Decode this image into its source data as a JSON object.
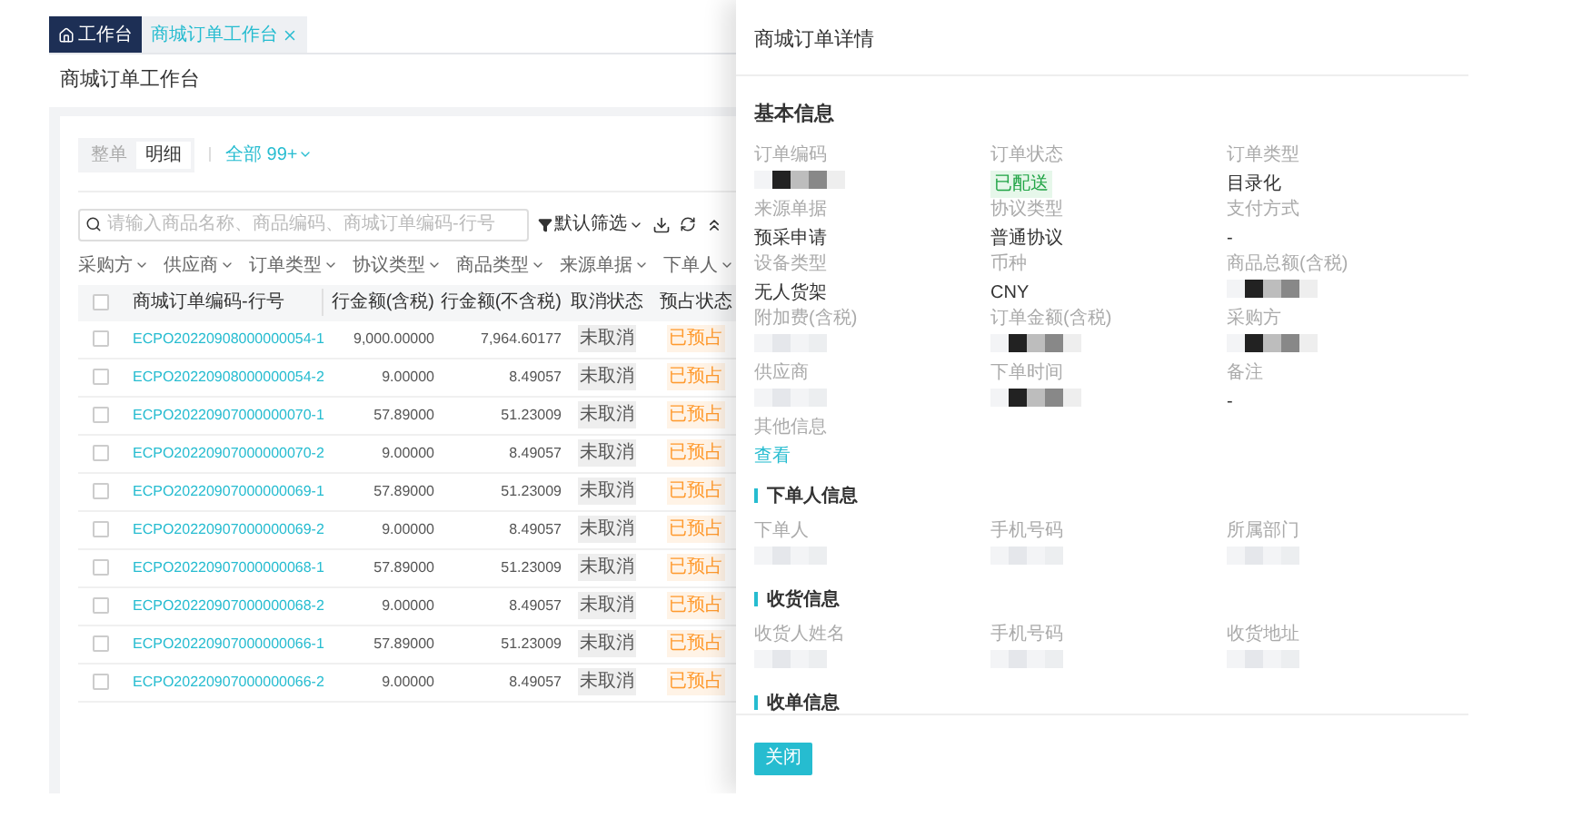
{
  "tabs": [
    {
      "label": "工作台",
      "selected": true,
      "closable": false
    },
    {
      "label": "商城订单工作台",
      "selected": false,
      "closable": true
    }
  ],
  "page_title": "商城订单工作台",
  "view_toggle": [
    {
      "label": "整单",
      "selected": false
    },
    {
      "label": "明细",
      "selected": true
    }
  ],
  "scope_filter": "全部 99+",
  "search": {
    "placeholder": "请输入商品名称、商品编码、商城订单编码-行号"
  },
  "default_filter": "默认筛选",
  "filters": [
    "采购方",
    "供应商",
    "订单类型",
    "协议类型",
    "商品类型",
    "来源单据",
    "下单人"
  ],
  "table": {
    "columns": [
      "商城订单编码-行号",
      "行金额(含税)",
      "行金额(不含税)",
      "取消状态",
      "预占状态"
    ],
    "all_checked": false,
    "rows": [
      {
        "checked": false,
        "code": "ECPO20220908000000054-1",
        "amount_tax": "9,000.00000",
        "amount_net": "7,964.60177",
        "cancel_status": "未取消",
        "reserve_status": "已预占"
      },
      {
        "checked": false,
        "code": "ECPO20220908000000054-2",
        "amount_tax": "9.00000",
        "amount_net": "8.49057",
        "cancel_status": "未取消",
        "reserve_status": "已预占"
      },
      {
        "checked": false,
        "code": "ECPO20220907000000070-1",
        "amount_tax": "57.89000",
        "amount_net": "51.23009",
        "cancel_status": "未取消",
        "reserve_status": "已预占"
      },
      {
        "checked": false,
        "code": "ECPO20220907000000070-2",
        "amount_tax": "9.00000",
        "amount_net": "8.49057",
        "cancel_status": "未取消",
        "reserve_status": "已预占"
      },
      {
        "checked": false,
        "code": "ECPO20220907000000069-1",
        "amount_tax": "57.89000",
        "amount_net": "51.23009",
        "cancel_status": "未取消",
        "reserve_status": "已预占"
      },
      {
        "checked": false,
        "code": "ECPO20220907000000069-2",
        "amount_tax": "9.00000",
        "amount_net": "8.49057",
        "cancel_status": "未取消",
        "reserve_status": "已预占"
      },
      {
        "checked": false,
        "code": "ECPO20220907000000068-1",
        "amount_tax": "57.89000",
        "amount_net": "51.23009",
        "cancel_status": "未取消",
        "reserve_status": "已预占"
      },
      {
        "checked": false,
        "code": "ECPO20220907000000068-2",
        "amount_tax": "9.00000",
        "amount_net": "8.49057",
        "cancel_status": "未取消",
        "reserve_status": "已预占"
      },
      {
        "checked": false,
        "code": "ECPO20220907000000066-1",
        "amount_tax": "57.89000",
        "amount_net": "51.23009",
        "cancel_status": "未取消",
        "reserve_status": "已预占"
      },
      {
        "checked": false,
        "code": "ECPO20220907000000066-2",
        "amount_tax": "9.00000",
        "amount_net": "8.49057",
        "cancel_status": "未取消",
        "reserve_status": "已预占"
      }
    ]
  },
  "drawer": {
    "title": "商城订单详情",
    "sections": [
      {
        "title": "基本信息",
        "fields": [
          {
            "label": "订单编码",
            "kind": "mosaic"
          },
          {
            "label": "订单状态",
            "kind": "tag",
            "value": "已配送"
          },
          {
            "label": "订单类型",
            "kind": "text",
            "value": "目录化"
          },
          {
            "label": "来源单据",
            "kind": "text",
            "value": "预采申请"
          },
          {
            "label": "协议类型",
            "kind": "text",
            "value": "普通协议"
          },
          {
            "label": "支付方式",
            "kind": "text",
            "value": "-"
          },
          {
            "label": "设备类型",
            "kind": "text",
            "value": "无人货架"
          },
          {
            "label": "币种",
            "kind": "text",
            "value": "CNY"
          },
          {
            "label": "商品总额(含税)",
            "kind": "mosaic"
          },
          {
            "label": "附加费(含税)",
            "kind": "blur"
          },
          {
            "label": "订单金额(含税)",
            "kind": "mosaic"
          },
          {
            "label": "采购方",
            "kind": "mosaic"
          },
          {
            "label": "供应商",
            "kind": "blur"
          },
          {
            "label": "下单时间",
            "kind": "mosaic"
          },
          {
            "label": "备注",
            "kind": "text",
            "value": "-"
          },
          {
            "label": "其他信息",
            "kind": "link",
            "value": "查看"
          }
        ]
      },
      {
        "title": "下单人信息",
        "fields": [
          {
            "label": "下单人",
            "kind": "blur"
          },
          {
            "label": "手机号码",
            "kind": "blur"
          },
          {
            "label": "所属部门",
            "kind": "blur"
          }
        ]
      },
      {
        "title": "收货信息",
        "fields": [
          {
            "label": "收货人姓名",
            "kind": "blur"
          },
          {
            "label": "手机号码",
            "kind": "blur"
          },
          {
            "label": "收货地址",
            "kind": "blur"
          }
        ]
      },
      {
        "title": "收单信息"
      }
    ],
    "close_button": "关闭"
  }
}
